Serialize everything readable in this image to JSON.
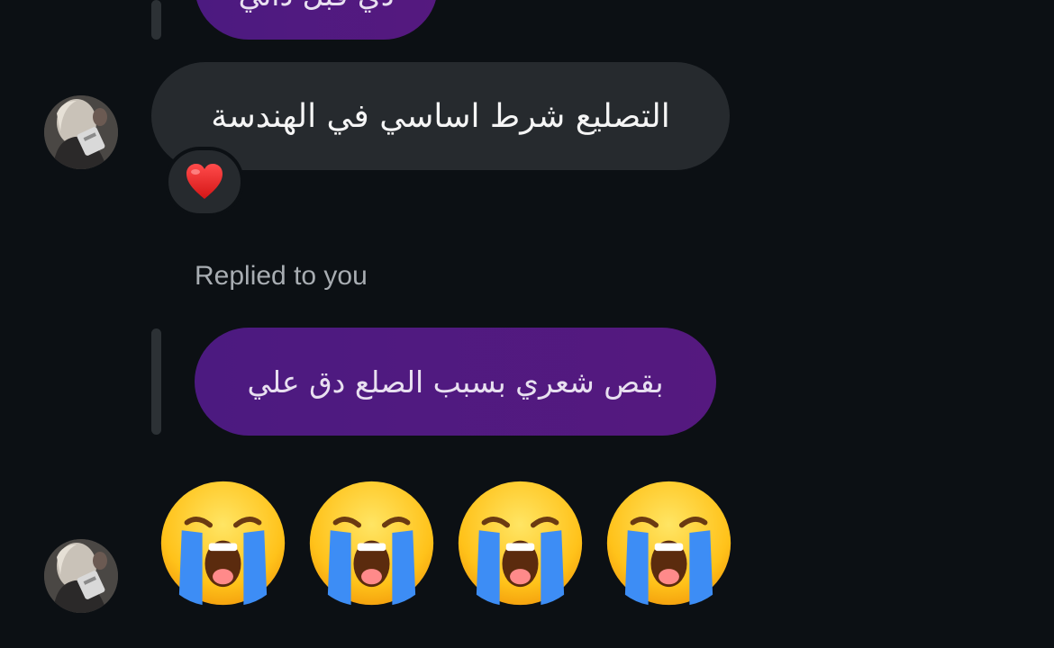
{
  "messages": {
    "top_partial": {
      "text": "ذي قبل ذاتي"
    },
    "message_1": {
      "text": "التصليع شرط اساسي في الهندسة",
      "reaction": "heart-emoji"
    },
    "reply_context": {
      "label": "Replied to you",
      "quoted_text": "بقص شعري بسبب الصلع دق علي"
    },
    "message_2": {
      "emojis": [
        "loudly-crying-face",
        "loudly-crying-face",
        "loudly-crying-face",
        "loudly-crying-face"
      ]
    }
  },
  "colors": {
    "background": "#0c1014",
    "sent_bubble": "#4c1a80",
    "received_bubble": "#262a2e",
    "muted_text": "#a8adb2"
  }
}
